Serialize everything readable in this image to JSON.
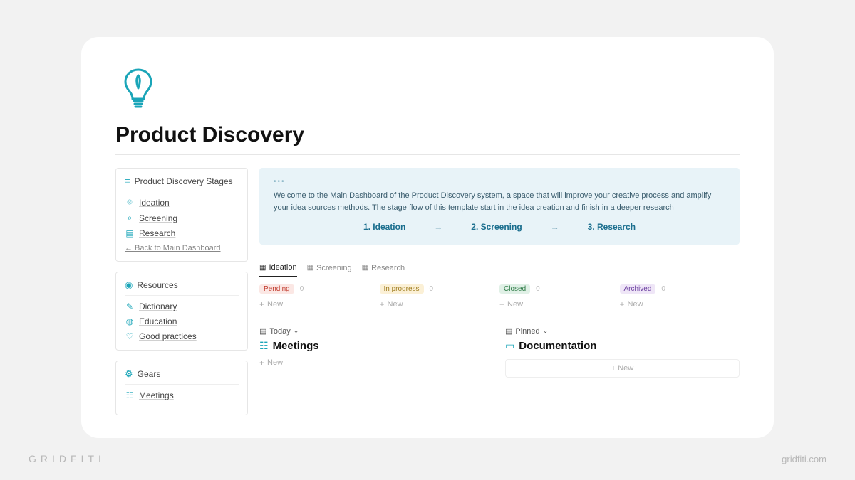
{
  "page": {
    "title": "Product Discovery"
  },
  "sidebar": {
    "stages": {
      "title": "Product Discovery Stages",
      "items": [
        {
          "icon": "lightbulb",
          "label": "Ideation"
        },
        {
          "icon": "search",
          "label": "Screening"
        },
        {
          "icon": "doc",
          "label": "Research"
        }
      ],
      "back": "← Back to Main Dashboard"
    },
    "resources": {
      "title": "Resources",
      "items": [
        {
          "icon": "chat",
          "label": "Dictionary"
        },
        {
          "icon": "globe",
          "label": "Education"
        },
        {
          "icon": "heart",
          "label": "Good practices"
        }
      ]
    },
    "gears": {
      "title": "Gears",
      "items": [
        {
          "icon": "people",
          "label": "Meetings"
        }
      ]
    }
  },
  "callout": {
    "text": "Welcome to the Main Dashboard of the Product Discovery system, a space that will improve your creative process and amplify your idea sources methods. The stage flow of this template start in the idea creation and finish in a deeper research",
    "steps": [
      "1. Ideation",
      "2. Screening",
      "3. Research"
    ]
  },
  "tabs": [
    {
      "label": "Ideation",
      "active": true
    },
    {
      "label": "Screening",
      "active": false
    },
    {
      "label": "Research",
      "active": false
    }
  ],
  "board": {
    "columns": [
      {
        "tag": "Pending",
        "color": "red",
        "count": "0"
      },
      {
        "tag": "In progress",
        "color": "yellow",
        "count": "0"
      },
      {
        "tag": "Closed",
        "color": "green",
        "count": "0"
      },
      {
        "tag": "Archived",
        "color": "purple",
        "count": "0"
      }
    ],
    "newLabel": "New"
  },
  "lower": {
    "left": {
      "view": "Today",
      "title": "Meetings",
      "newLabel": "New"
    },
    "right": {
      "view": "Pinned",
      "title": "Documentation",
      "newLabel": "+ New"
    }
  },
  "footer": {
    "left": "GRIDFITI",
    "right": "gridfiti.com"
  },
  "glyphs": {
    "lightbulb": "💡",
    "search": "🔍",
    "doc": "📄",
    "chat": "💬",
    "globe": "🌐",
    "heart": "♡",
    "people": "👥",
    "gear": "⚙",
    "list": "≡",
    "box": "▦",
    "pin": "📌",
    "cal": "📅",
    "plus": "+"
  }
}
